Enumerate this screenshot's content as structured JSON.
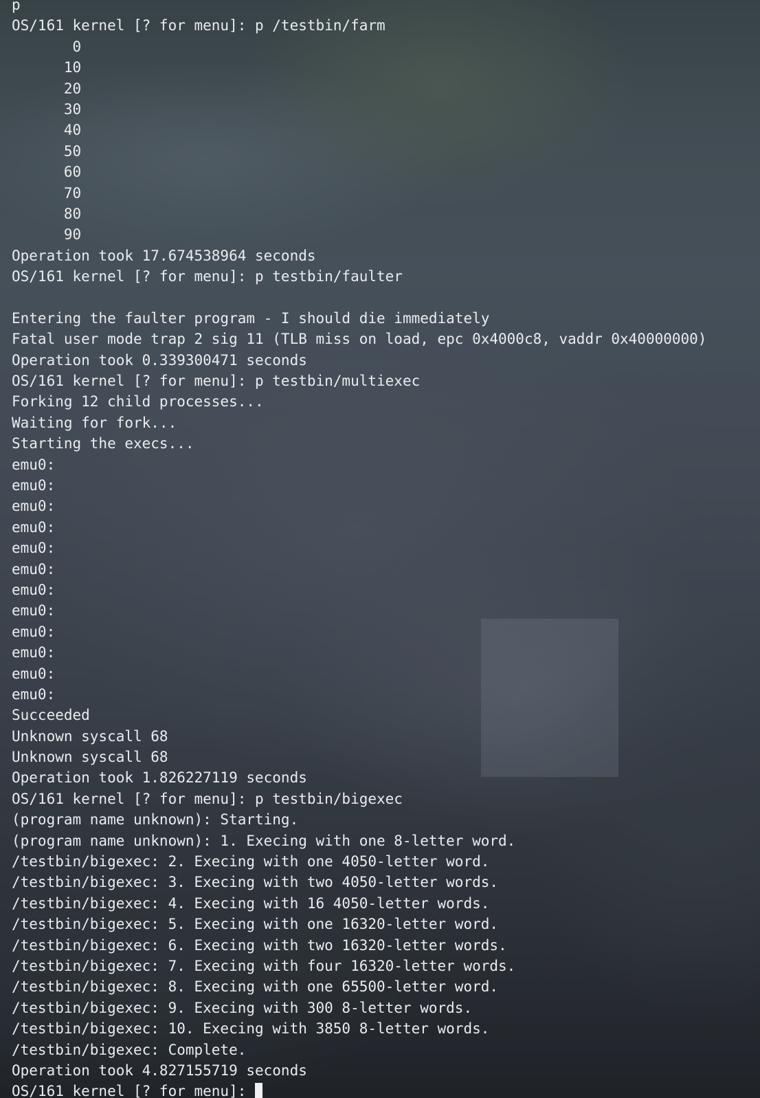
{
  "terminal": {
    "lines": [
      "p",
      "OS/161 kernel [? for menu]: p /testbin/farm",
      "       0",
      "      10",
      "      20",
      "      30",
      "      40",
      "      50",
      "      60",
      "      70",
      "      80",
      "      90",
      "Operation took 17.674538964 seconds",
      "OS/161 kernel [? for menu]: p testbin/faulter",
      "",
      "Entering the faulter program - I should die immediately",
      "Fatal user mode trap 2 sig 11 (TLB miss on load, epc 0x4000c8, vaddr 0x40000000)",
      "Operation took 0.339300471 seconds",
      "OS/161 kernel [? for menu]: p testbin/multiexec",
      "Forking 12 child processes...",
      "Waiting for fork...",
      "Starting the execs...",
      "emu0:",
      "emu0:",
      "emu0:",
      "emu0:",
      "emu0:",
      "emu0:",
      "emu0:",
      "emu0:",
      "emu0:",
      "emu0:",
      "emu0:",
      "emu0:",
      "Succeeded",
      "Unknown syscall 68",
      "Unknown syscall 68",
      "Operation took 1.826227119 seconds",
      "OS/161 kernel [? for menu]: p testbin/bigexec",
      "(program name unknown): Starting.",
      "(program name unknown): 1. Execing with one 8-letter word.",
      "/testbin/bigexec: 2. Execing with one 4050-letter word.",
      "/testbin/bigexec: 3. Execing with two 4050-letter words.",
      "/testbin/bigexec: 4. Execing with 16 4050-letter words.",
      "/testbin/bigexec: 5. Execing with one 16320-letter word.",
      "/testbin/bigexec: 6. Execing with two 16320-letter words.",
      "/testbin/bigexec: 7. Execing with four 16320-letter words.",
      "/testbin/bigexec: 8. Execing with one 65500-letter word.",
      "/testbin/bigexec: 9. Execing with 300 8-letter words.",
      "/testbin/bigexec: 10. Execing with 3850 8-letter words.",
      "/testbin/bigexec: Complete.",
      "Operation took 4.827155719 seconds"
    ],
    "prompt": "OS/161 kernel [? for menu]: "
  },
  "colors": {
    "text": "#eaecef",
    "cursor": "#f0f0f0"
  }
}
